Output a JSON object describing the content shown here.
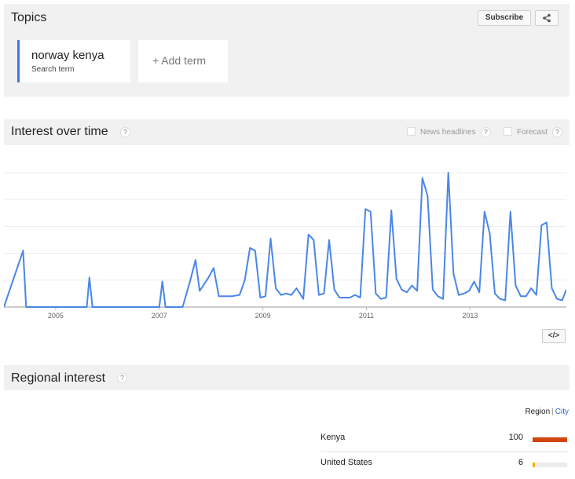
{
  "topics": {
    "title": "Topics",
    "subscribe_label": "Subscribe",
    "share_icon": "share-icon",
    "terms": [
      {
        "name": "norway kenya",
        "sublabel": "Search term",
        "color": "#3b78e7"
      }
    ],
    "add_term_label": "+ Add term"
  },
  "interest": {
    "title": "Interest over time",
    "help_glyph": "?",
    "news_label": "News headlines",
    "forecast_label": "Forecast",
    "embed_label": "</>"
  },
  "chart_data": {
    "type": "line",
    "title": "",
    "xlabel": "",
    "ylabel": "",
    "x_tick_labels": [
      "2005",
      "2007",
      "2009",
      "2011",
      "2013"
    ],
    "x_ticks": [
      2005,
      2007,
      2009,
      2011,
      2013
    ],
    "xlim": [
      2004.0,
      2014.86
    ],
    "ylim": [
      0,
      100
    ],
    "grid": true,
    "series": [
      {
        "color": "#4a86e8",
        "x": [
          2004.0,
          2004.37,
          2004.43,
          2004.5,
          2005.6,
          2005.65,
          2005.71,
          2007.0,
          2007.06,
          2007.12,
          2007.45,
          2007.6,
          2007.7,
          2007.78,
          2007.95,
          2008.05,
          2008.15,
          2008.25,
          2008.4,
          2008.55,
          2008.65,
          2008.75,
          2008.85,
          2008.95,
          2009.05,
          2009.15,
          2009.25,
          2009.35,
          2009.45,
          2009.55,
          2009.65,
          2009.78,
          2009.88,
          2009.98,
          2010.08,
          2010.18,
          2010.28,
          2010.38,
          2010.48,
          2010.58,
          2010.68,
          2010.78,
          2010.88,
          2010.98,
          2011.08,
          2011.18,
          2011.28,
          2011.38,
          2011.48,
          2011.58,
          2011.68,
          2011.78,
          2011.88,
          2011.98,
          2012.08,
          2012.18,
          2012.28,
          2012.38,
          2012.48,
          2012.58,
          2012.68,
          2012.78,
          2012.88,
          2012.98,
          2013.08,
          2013.18,
          2013.28,
          2013.38,
          2013.48,
          2013.58,
          2013.68,
          2013.78,
          2013.88,
          2013.98,
          2014.08,
          2014.18,
          2014.28,
          2014.38,
          2014.48,
          2014.58,
          2014.68,
          2014.78,
          2014.86
        ],
        "values": [
          0,
          42,
          0,
          0,
          0,
          22,
          0,
          0,
          19,
          0,
          0,
          20,
          35,
          12,
          22,
          29,
          8,
          8,
          8,
          9,
          20,
          44,
          42,
          7,
          8,
          51,
          14,
          9,
          10,
          9,
          14,
          6,
          54,
          50,
          9,
          10,
          50,
          13,
          7,
          7,
          7,
          9,
          7,
          73,
          71,
          10,
          6,
          7,
          72,
          21,
          13,
          11,
          16,
          12,
          96,
          83,
          13,
          8,
          6,
          100,
          25,
          9,
          10,
          12,
          19,
          11,
          71,
          55,
          10,
          6,
          5,
          71,
          16,
          8,
          8,
          14,
          9,
          61,
          63,
          14,
          6,
          5,
          13
        ]
      }
    ]
  },
  "regional": {
    "title": "Regional interest",
    "help_glyph": "?",
    "toggle_region": "Region",
    "toggle_city": "City",
    "rows": [
      {
        "name": "Kenya",
        "value": "100",
        "fraction": 1.0
      },
      {
        "name": "United States",
        "value": "6",
        "fraction": 0.06
      }
    ],
    "accent_color": "#d14510",
    "minor_color": "#f4b400"
  }
}
